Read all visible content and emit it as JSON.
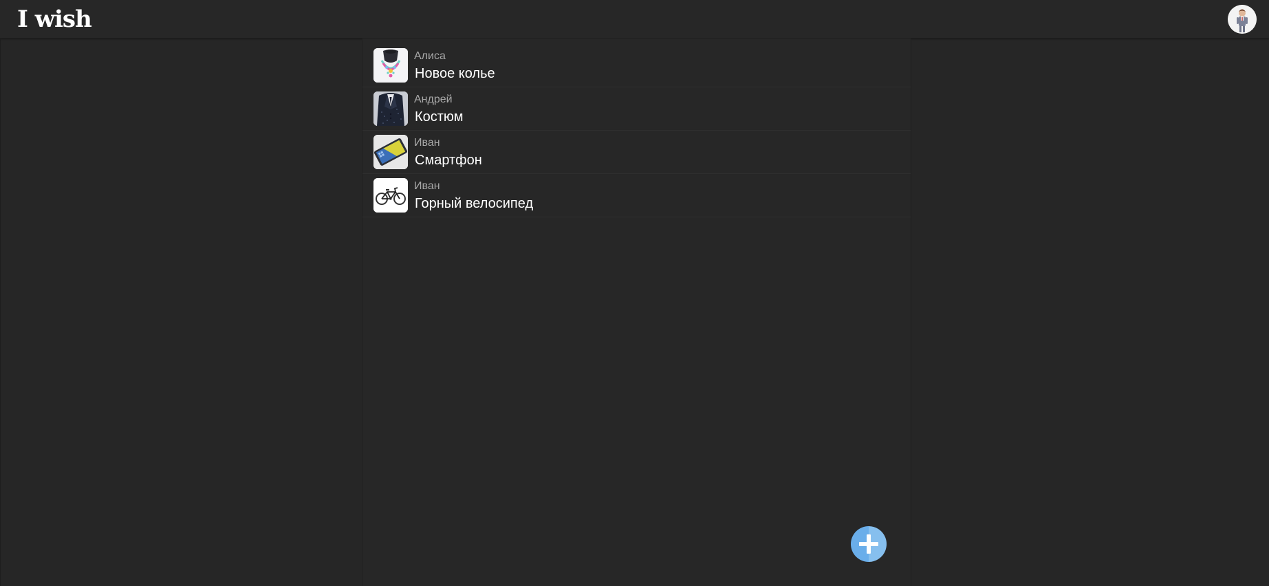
{
  "app": {
    "logo_text": "I wish"
  },
  "header": {
    "avatar_icon": "user-avatar-icon"
  },
  "wishes": [
    {
      "owner": "Алиса",
      "title": "Новое колье",
      "thumb_icon": "necklace-icon"
    },
    {
      "owner": "Андрей",
      "title": "Костюм",
      "thumb_icon": "suit-icon"
    },
    {
      "owner": "Иван",
      "title": "Смартфон",
      "thumb_icon": "smartphone-icon"
    },
    {
      "owner": "Иван",
      "title": "Горный велосипед",
      "thumb_icon": "bicycle-icon"
    }
  ],
  "fab": {
    "icon": "plus-icon",
    "color": "#6aaeea"
  }
}
